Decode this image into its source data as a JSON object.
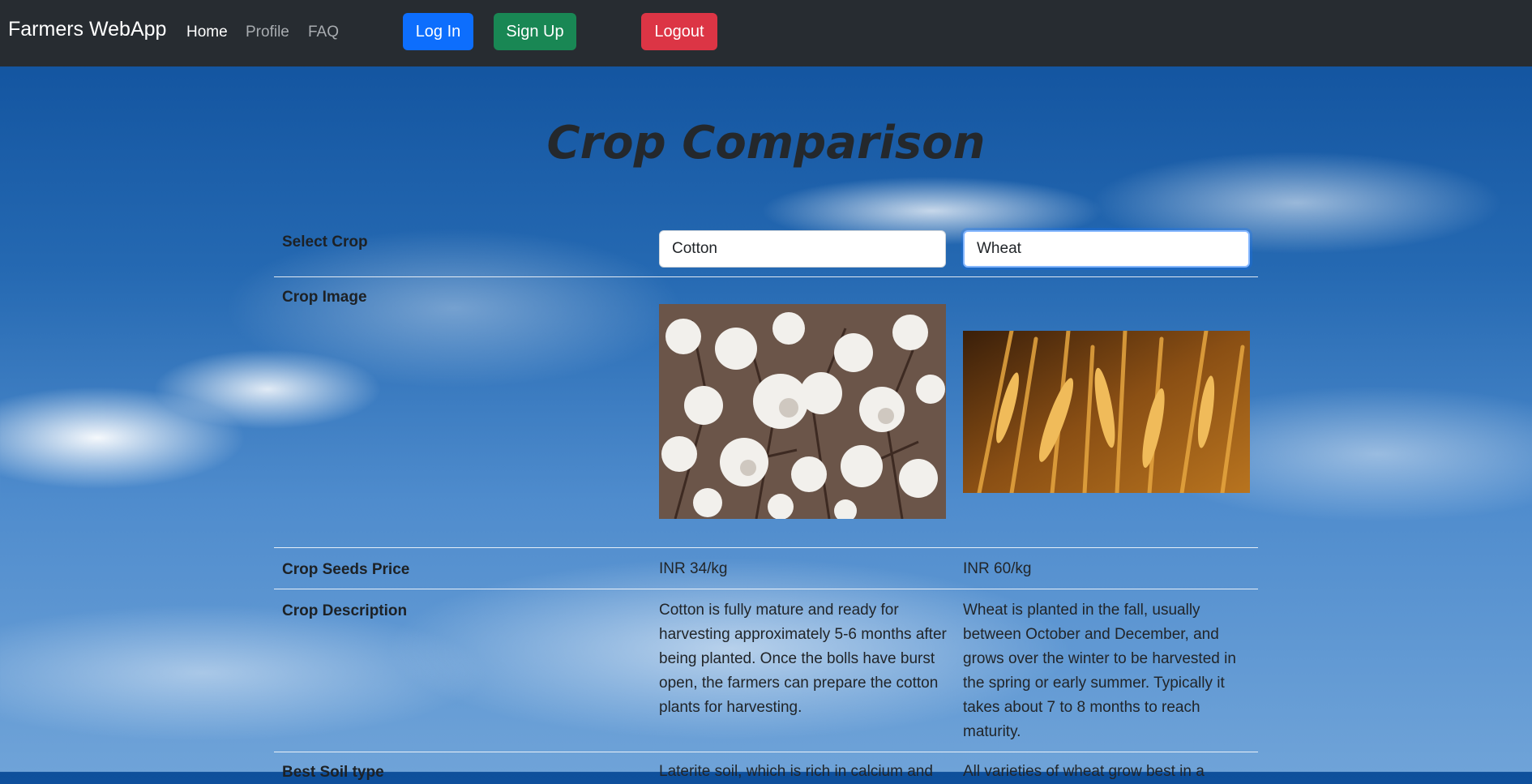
{
  "navbar": {
    "brand": "Farmers WebApp",
    "links": [
      "Home",
      "Profile",
      "FAQ"
    ],
    "login_label": "Log In",
    "signup_label": "Sign Up",
    "logout_label": "Logout"
  },
  "page": {
    "title": "Crop Comparison"
  },
  "table": {
    "rows": {
      "select": "Select Crop",
      "image": "Crop Image",
      "price": "Crop Seeds Price",
      "description": "Crop Description",
      "soil": "Best Soil type"
    },
    "crop1": {
      "name": "Cotton",
      "price": "INR 34/kg",
      "description": "Cotton is fully mature and ready for harvesting approximately 5-6 months after being planted. Once the bolls have burst open, the farmers can prepare the cotton plants for harvesting.",
      "soil": "Laterite soil, which is rich in calcium and"
    },
    "crop2": {
      "name": "Wheat",
      "price": "INR 60/kg",
      "description": "Wheat is planted in the fall, usually between October and December, and grows over the winter to be harvested in the spring or early summer. Typically it takes about 7 to 8 months to reach maturity.",
      "soil": "All varieties of wheat grow best in a"
    }
  }
}
